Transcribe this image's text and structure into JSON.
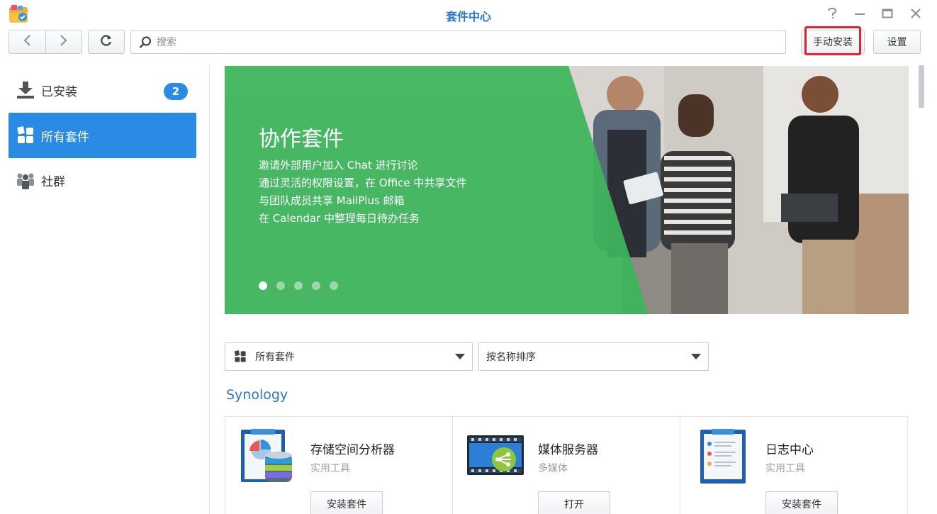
{
  "window": {
    "title": "套件中心",
    "app_icon": "package-center-icon",
    "controls": [
      "help-icon",
      "minimize-icon",
      "maximize-icon",
      "close-icon"
    ]
  },
  "toolbar": {
    "back_icon": "chevron-left-icon",
    "forward_icon": "chevron-right-icon",
    "refresh_icon": "refresh-icon",
    "search": {
      "placeholder": "搜索",
      "value": "",
      "icon": "search-icon"
    },
    "manual_install_label": "手动安装",
    "settings_label": "设置"
  },
  "sidebar": {
    "items": [
      {
        "label": "已安装",
        "icon": "download-icon",
        "badge": "2",
        "active": false
      },
      {
        "label": "所有套件",
        "icon": "grid-icon",
        "active": true
      },
      {
        "label": "社群",
        "icon": "community-icon",
        "active": false
      }
    ]
  },
  "banner": {
    "title": "协作套件",
    "lines": [
      "邀请外部用户加入 Chat 进行讨论",
      "通过灵活的权限设置，在 Office 中共享文件",
      "与团队成员共享 MailPlus 邮箱",
      "在 Calendar 中整理每日待办任务"
    ],
    "slide_count": 5,
    "active_slide": 1
  },
  "filters": {
    "category": {
      "selected": "所有套件",
      "icon": "grid-icon"
    },
    "sort": {
      "selected": "按名称排序"
    }
  },
  "section": {
    "title": "Synology"
  },
  "packages": [
    {
      "name": "存储空间分析器",
      "category": "实用工具",
      "button": "安装套件",
      "icon": "storage-analyzer-icon"
    },
    {
      "name": "媒体服务器",
      "category": "多媒体",
      "button": "打开",
      "icon": "media-server-icon"
    },
    {
      "name": "日志中心",
      "category": "实用工具",
      "button": "安装套件",
      "icon": "log-center-icon"
    }
  ],
  "colors": {
    "accent": "#2a8be5",
    "title_blue": "#2d77c6",
    "banner_green": "#3fb55c",
    "highlight_red": "#e8222a"
  }
}
